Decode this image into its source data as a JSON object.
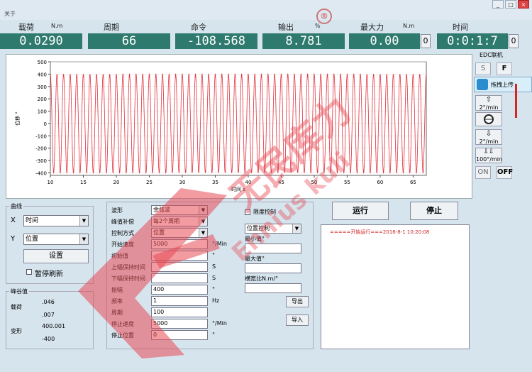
{
  "window": {
    "menu": "关于",
    "btn_min": "_",
    "btn_max": "□",
    "btn_close": "×"
  },
  "metrics": [
    {
      "label": "载荷",
      "unit": "N.m",
      "value": "0.0290"
    },
    {
      "label": "周期",
      "unit": "",
      "value": "66"
    },
    {
      "label": "命令",
      "unit": "",
      "value": "-108.568"
    },
    {
      "label": "输出",
      "unit": "%",
      "value": "8.781"
    },
    {
      "label": "最大力",
      "unit": "N.m",
      "value": "0.00",
      "zero": "0"
    },
    {
      "label": "时间",
      "unit": "",
      "value": "0:0:1:7",
      "zero": "0"
    }
  ],
  "chart_data": {
    "type": "line",
    "title": "",
    "xlabel": "时间 s",
    "ylabel": "位移 °",
    "xlim": [
      10,
      67
    ],
    "ylim": [
      -420,
      500
    ],
    "x_ticks": [
      "10",
      "15",
      "20",
      "25",
      "30",
      "35",
      "40",
      "45",
      "50",
      "55",
      "60",
      "65"
    ],
    "y_ticks": [
      "500",
      "400",
      "300",
      "200",
      "100",
      "0",
      "-100",
      "-200",
      "-300",
      "-400"
    ],
    "series": [
      {
        "amplitude": 400,
        "frequency_hz": 1,
        "x_start": 10,
        "x_end": 67,
        "color": "#e0303a"
      }
    ]
  },
  "edc": {
    "title": "EDC联机",
    "s": "S",
    "f": "F",
    "tooltip": "拖拽上传",
    "up": "2°/min",
    "stop": "",
    "down": "2°/min",
    "fast": "100°/min",
    "on": "ON",
    "off": "OFF"
  },
  "curve": {
    "caption": "曲线",
    "x_label": "X",
    "x_value": "时间",
    "y_label": "Y",
    "y_value": "位置",
    "set_button": "设置",
    "pause_label": "暂停刷新"
  },
  "peak": {
    "caption": "峰谷值",
    "load_label": "载荷",
    "load_max": ".046",
    "load_min": ".007",
    "disp_label": "变形",
    "disp_max": "400.001",
    "disp_min": "-400"
  },
  "params": {
    "waveform_label": "波形",
    "waveform_value": "余弦波",
    "peak_comp_label": "峰值补偿",
    "peak_comp_value": "每2个周期",
    "control_label": "控制方式",
    "control_value": "位置",
    "start_speed_label": "开始速度",
    "start_speed_value": "5000",
    "start_speed_unit": "°/Min",
    "init_label": "初始值",
    "init_value": "",
    "init_unit": "°",
    "upper_hold_label": "上幅保持时间",
    "upper_hold_value": "",
    "upper_hold_unit": "S",
    "lower_hold_label": "下幅保持时间",
    "lower_hold_value": "",
    "lower_hold_unit": "S",
    "amp_label": "振幅",
    "amp_value": "400",
    "amp_unit": "°",
    "freq_label": "频率",
    "freq_value": "1",
    "freq_unit": "Hz",
    "cycles_label": "周期",
    "cycles_value": "100",
    "stop_speed_label": "停止速度",
    "stop_speed_value": "5000",
    "stop_speed_unit": "°/Min",
    "stop_pos_label": "停止位置",
    "stop_pos_value": "0",
    "stop_pos_unit": "°"
  },
  "limit": {
    "check_label": "限度控制",
    "mode_value": "位置控制",
    "min_label": "最小值°",
    "max_label": "最大值°",
    "ratio_label": "横宽比N.m/°",
    "export_button": "导出",
    "import_button": "导入"
  },
  "actions": {
    "run": "运行",
    "stop": "停止"
  },
  "log": {
    "line": "=====开始运行===2016-8-1 10:20:08"
  },
  "watermark": {
    "cn": "无民库力",
    "en": "Ennius kuli",
    "reg": "®"
  }
}
